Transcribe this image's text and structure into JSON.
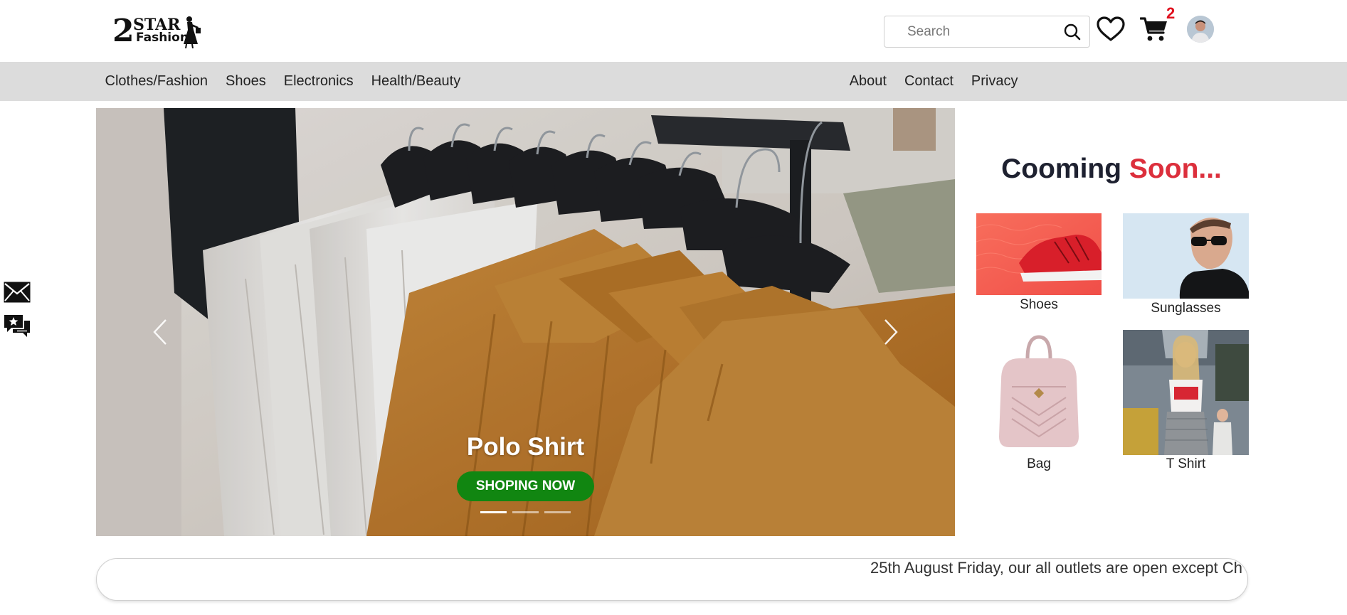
{
  "header": {
    "logo": {
      "line1": "2STAR",
      "line2": "Fashion"
    },
    "search": {
      "placeholder": "Search",
      "value": ""
    },
    "cart_count": "2"
  },
  "nav": {
    "left": [
      "Clothes/Fashion",
      "Shoes",
      "Electronics",
      "Health/Beauty"
    ],
    "right": [
      "About",
      "Contact",
      "Privacy"
    ]
  },
  "hero": {
    "title": "Polo Shirt",
    "button": "SHOPING NOW",
    "slides_total": 3,
    "active_slide": 1
  },
  "coming_soon": {
    "title_part1": "Cooming",
    "title_part2": "Soon...",
    "accent_color": "#dc2f3c",
    "items": [
      {
        "label": "Shoes"
      },
      {
        "label": "Sunglasses"
      },
      {
        "label": "Bag"
      },
      {
        "label": "T Shirt"
      }
    ]
  },
  "ticker": {
    "text": "25th August Friday, our all outlets are open except Ch"
  },
  "colors": {
    "nav_bg": "#dcdcdc",
    "button_green": "#118611",
    "badge_red": "#e0101e"
  },
  "icons": [
    "heart-icon",
    "cart-icon",
    "search-icon",
    "mail-icon",
    "review-icon",
    "chevron-left-icon",
    "chevron-right-icon"
  ]
}
